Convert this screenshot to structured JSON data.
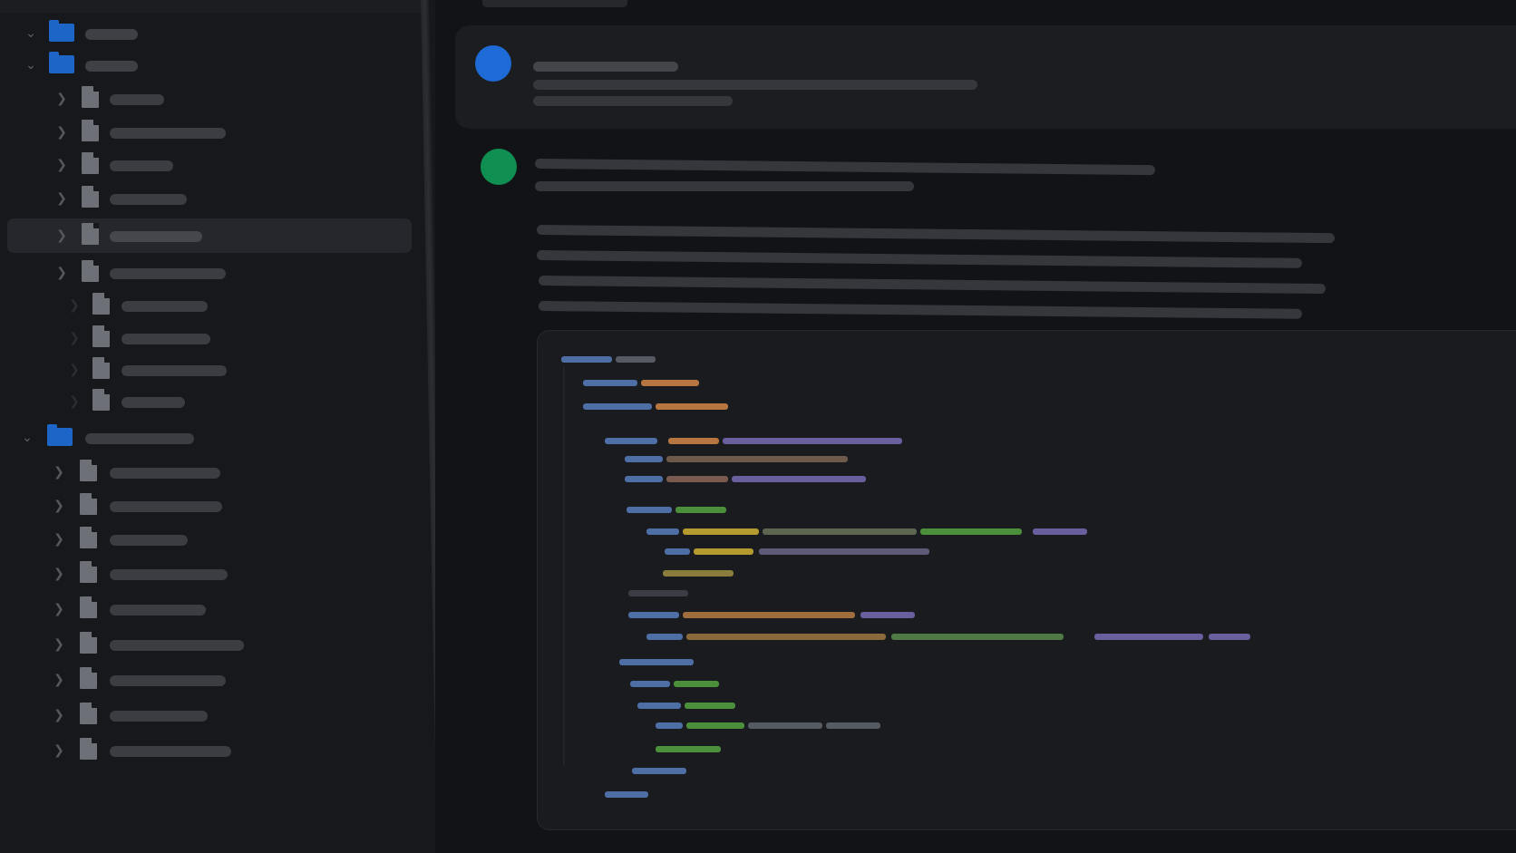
{
  "window": {
    "title": ""
  },
  "colors": {
    "background": "#121316",
    "sidebar_background": "#17181b",
    "folder_icon": "#1d66c8",
    "file_icon": "#6d7077",
    "selection": "#25272c",
    "user_avatar": "#1e6ad6",
    "assistant_avatar": "#0f8f52",
    "code_keyword": "#4e6fa6",
    "code_string": "#b7763f",
    "code_function": "#6a5f9e",
    "code_value": "#4c8f3b",
    "code_number": "#b59a30",
    "code_plain": "#565a62"
  },
  "sidebar": {
    "icons": {
      "folder": "folder-icon",
      "file": "file-icon",
      "expanded": "chevron-down-icon",
      "collapsed": "chevron-right-icon"
    },
    "items": [
      {
        "kind": "folder",
        "label": "",
        "expanded": true
      },
      {
        "kind": "folder",
        "label": "",
        "expanded": true
      },
      {
        "kind": "file",
        "label": ""
      },
      {
        "kind": "file",
        "label": ""
      },
      {
        "kind": "file",
        "label": ""
      },
      {
        "kind": "file",
        "label": ""
      },
      {
        "kind": "file",
        "label": "",
        "selected": true
      },
      {
        "kind": "file",
        "label": ""
      },
      {
        "kind": "file",
        "label": ""
      },
      {
        "kind": "file",
        "label": ""
      },
      {
        "kind": "file",
        "label": ""
      },
      {
        "kind": "file",
        "label": ""
      },
      {
        "kind": "folder",
        "label": "",
        "expanded": true
      },
      {
        "kind": "file",
        "label": ""
      },
      {
        "kind": "file",
        "label": ""
      },
      {
        "kind": "file",
        "label": ""
      },
      {
        "kind": "file",
        "label": ""
      },
      {
        "kind": "file",
        "label": ""
      },
      {
        "kind": "file",
        "label": ""
      },
      {
        "kind": "file",
        "label": ""
      },
      {
        "kind": "file",
        "label": ""
      },
      {
        "kind": "file",
        "label": ""
      }
    ]
  },
  "conversation": {
    "messages": [
      {
        "role": "user",
        "avatar": "avatar-icon",
        "text": ""
      },
      {
        "role": "assistant",
        "avatar": "avatar-icon",
        "text": "",
        "code": ""
      }
    ]
  }
}
